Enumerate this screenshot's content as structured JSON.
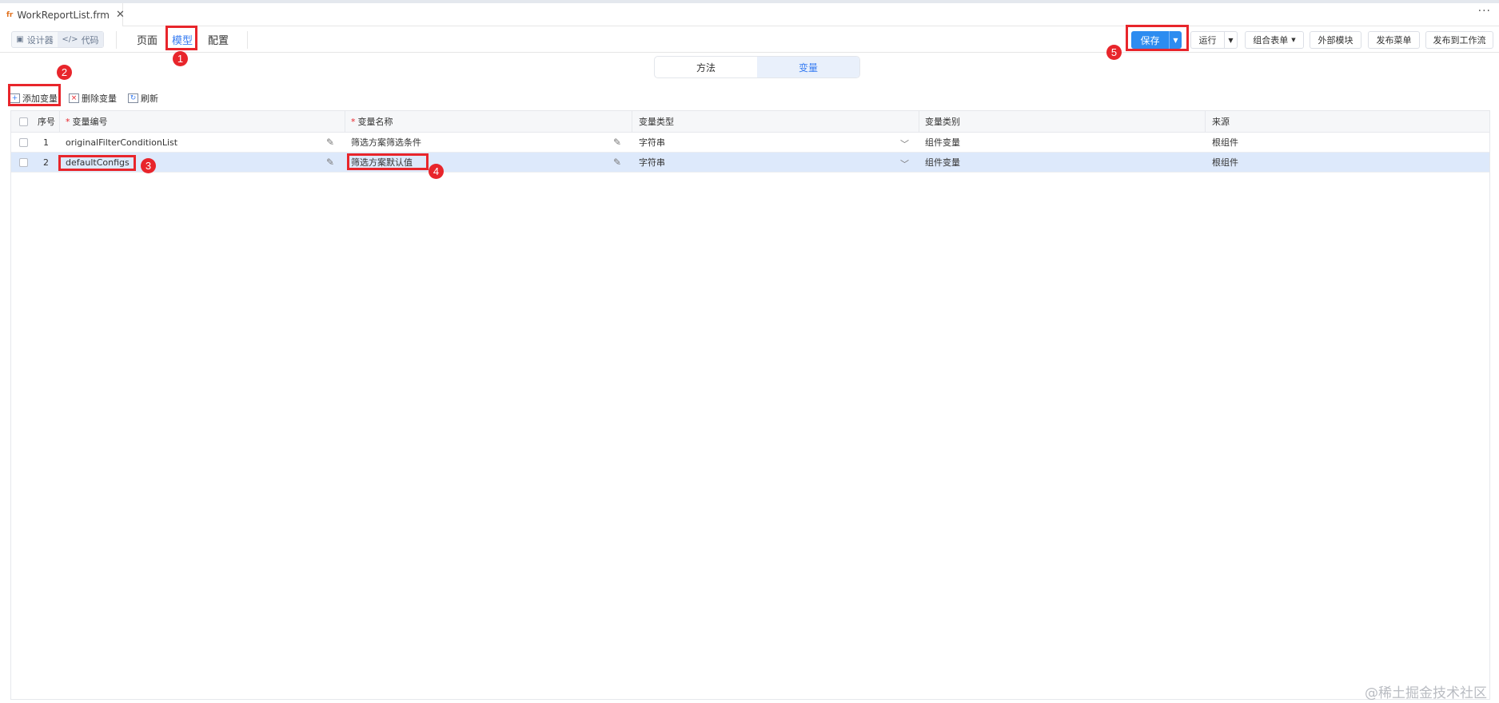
{
  "file_tab": {
    "icon": "fr",
    "name": "WorkReportList.frm",
    "close": "✕"
  },
  "more": "···",
  "view_switch": {
    "designer": "设计器",
    "code": "代码",
    "designer_icon": "layout-icon",
    "code_icon": "code-icon"
  },
  "nav_tabs": [
    "页面",
    "模型",
    "配置"
  ],
  "toolbar_buttons": {
    "save": "保存",
    "run": "运行",
    "combo_form": "组合表单",
    "external_module": "外部模块",
    "publish_menu": "发布菜单",
    "publish_workflow": "发布到工作流"
  },
  "sub_tabs": [
    "方法",
    "变量"
  ],
  "actions": {
    "add": "添加变量",
    "delete": "删除变量",
    "refresh": "刷新"
  },
  "table": {
    "headers": {
      "index": "序号",
      "code": "变量编号",
      "name": "变量名称",
      "type": "变量类型",
      "category": "变量类别",
      "source": "来源"
    },
    "rows": [
      {
        "index": "1",
        "code": "originalFilterConditionList",
        "name": "筛选方案筛选条件",
        "type": "字符串",
        "category": "组件变量",
        "source": "根组件"
      },
      {
        "index": "2",
        "code": "defaultConfigs",
        "name": "筛选方案默认值",
        "type": "字符串",
        "category": "组件变量",
        "source": "根组件"
      }
    ]
  },
  "annotations": [
    "1",
    "2",
    "3",
    "4",
    "5"
  ],
  "watermark": "@稀土掘金技术社区",
  "colors": {
    "accent": "#3a7ef2",
    "save_button": "#2d8cf0",
    "highlight": "#e8252b",
    "selected_row": "#dde9fb"
  }
}
